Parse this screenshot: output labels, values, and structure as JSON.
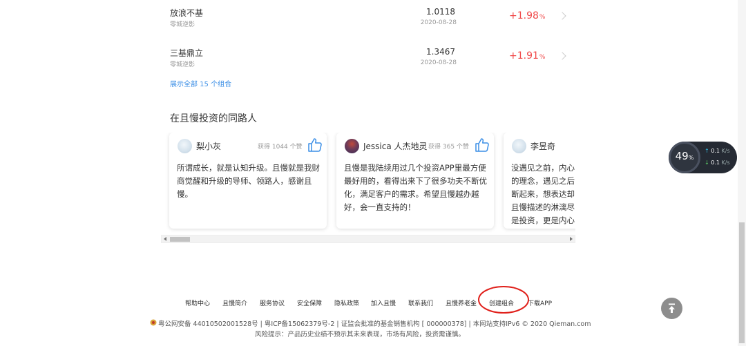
{
  "funds": [
    {
      "name": "放浪不基",
      "sub": "零城逆影",
      "nav": "1.0118",
      "date": "2020-08-28",
      "change": "+1.98",
      "unit": "%"
    },
    {
      "name": "三基鼎立",
      "sub": "零城逆影",
      "nav": "1.3467",
      "date": "2020-08-28",
      "change": "+1.91",
      "unit": "%"
    }
  ],
  "show_all": "展示全部 15 个组合",
  "section_title": "在且慢投资的同路人",
  "cards": [
    {
      "name": "梨小灰",
      "likes": "获得 1044 个赞",
      "text": "所谓成长，就是认知升级。且慢就是我财商觉醒和升级的导师、领路人，感谢且慢。"
    },
    {
      "name": "Jessica 人杰地灵",
      "likes": "获得 365 个赞",
      "text": "且慢是我陆续用过几个投资APP里最方便最好用的，看得出来下了很多功夫不断优化，满足客户的需求。希望且慢越办越好，会一直支持的！"
    },
    {
      "name": "李昱奇",
      "likes": "",
      "text": "没遇见之前，内心的理念，遇见之后断起来，想表达却且慢描述的淋漓尽是投资，更是内心"
    }
  ],
  "footer_links": [
    "帮助中心",
    "且慢简介",
    "服务协议",
    "安全保障",
    "隐私政策",
    "加入且慢",
    "联系我们",
    "且慢养老金",
    "创建组合",
    "下载APP"
  ],
  "footer_line1": "粤公网安备 44010502001528号 | 粤ICP备15062379号-2 | 证监会批准的基金销售机构 [ 000000378] | 本网站支持IPv6 © 2020 Qieman.com",
  "footer_line2": "风险提示：产品历史业绩不预示其未来表现，市场有风险，投资需谨慎。",
  "widget": {
    "percent": "49",
    "pct_unit": "%",
    "up": "0.1",
    "down": "0.1",
    "rate_unit": "K/s"
  },
  "colors": {
    "positive": "#f04949",
    "link": "#3a8ee6",
    "annotation": "#e0201b"
  }
}
